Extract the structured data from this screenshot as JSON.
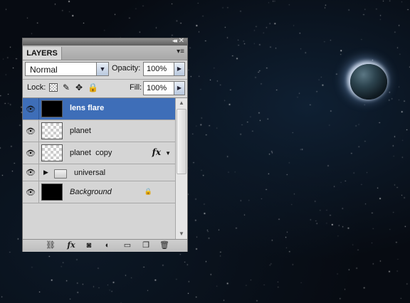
{
  "panel": {
    "tab_label": "LAYERS",
    "collapse_glyph": "◂◂",
    "close_glyph": "✕",
    "menu_glyph": "▾≡"
  },
  "blend_mode": {
    "value": "Normal"
  },
  "opacity": {
    "label": "Opacity:",
    "value": "100%"
  },
  "fill": {
    "label": "Fill:",
    "value": "100%"
  },
  "lock": {
    "label": "Lock:",
    "icons": [
      "lock-transparent-icon",
      "lock-image-icon",
      "lock-position-icon",
      "lock-all-icon"
    ]
  },
  "layers": [
    {
      "name": "lens flare",
      "thumbnail": "black",
      "visible": true,
      "selected": true
    },
    {
      "name": "planet",
      "thumbnail": "transparent",
      "visible": true,
      "selected": false
    },
    {
      "name": "planet  copy",
      "thumbnail": "transparent",
      "visible": true,
      "selected": false,
      "fx": "fx"
    },
    {
      "name": "universal",
      "type": "group",
      "visible": true,
      "selected": false
    },
    {
      "name": "Background",
      "thumbnail": "black",
      "visible": true,
      "selected": false,
      "locked": true
    }
  ],
  "toolbar": {
    "icons": [
      "link-layers-icon",
      "fx-icon",
      "mask-icon",
      "adjustment-layer-icon",
      "new-group-icon",
      "new-layer-icon",
      "trash-icon"
    ],
    "fx_label": "fx"
  },
  "colors": {
    "selection": "#3e6eb8",
    "panel_bg": "#d8d8d8"
  }
}
